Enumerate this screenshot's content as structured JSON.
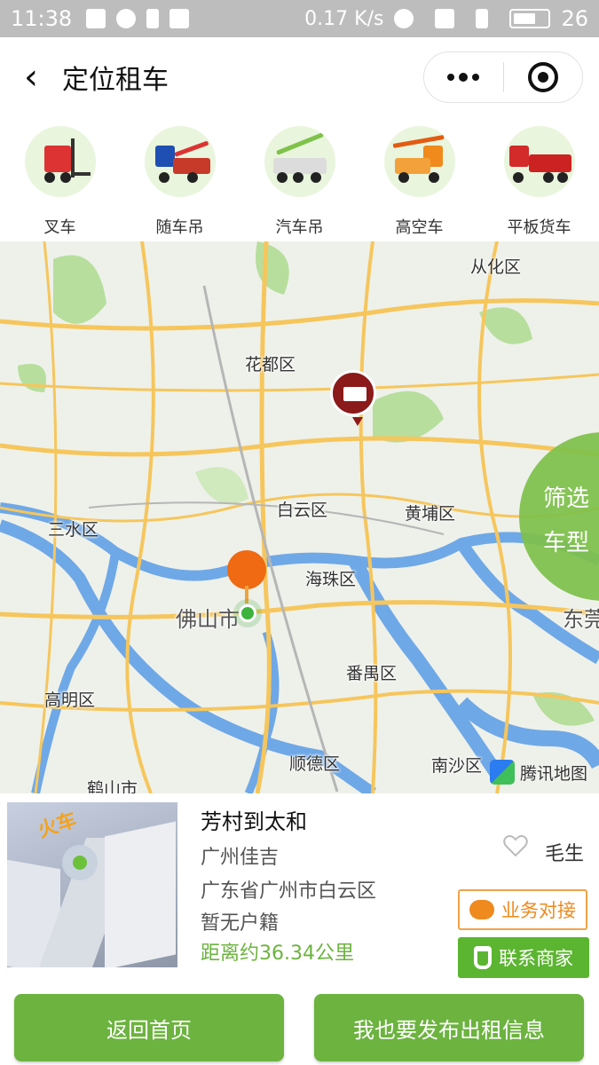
{
  "status_bar": {
    "time": "11:38",
    "net_speed": "0.17 K/s",
    "network": "2G 4G",
    "battery": "26"
  },
  "nav": {
    "title": "定位租车"
  },
  "categories": [
    {
      "label": "叉车",
      "icon": "forklift-icon"
    },
    {
      "label": "随车吊",
      "icon": "crane-truck-icon"
    },
    {
      "label": "汽车吊",
      "icon": "mobile-crane-icon"
    },
    {
      "label": "高空车",
      "icon": "aerial-truck-icon"
    },
    {
      "label": "平板货车",
      "icon": "flatbed-truck-icon"
    }
  ],
  "map": {
    "labels": {
      "conghua": "从化区",
      "huadu": "花都区",
      "baiyun": "白云区",
      "huangpu": "黄埔区",
      "sanshui": "三水区",
      "haizhu": "海珠区",
      "foshan": "佛山市",
      "dongguan": "东莞",
      "panyu": "番禺区",
      "gaoming": "高明区",
      "shunde": "顺德区",
      "nansha": "南沙区",
      "heshan": "鹤山市"
    },
    "filter": {
      "line1": "筛选",
      "line2": "车型"
    },
    "provider": "腾讯地图",
    "colors": {
      "water": "#6fa8e6",
      "green": "#a9d98a",
      "road": "#f6c65c",
      "filter": "#7ec04a"
    }
  },
  "listing": {
    "title": "芳村到太和",
    "company": "广州佳吉",
    "address": "广东省广州市白云区",
    "hukou": "暂无户籍",
    "distance": "距离约36.34公里",
    "owner": "毛生",
    "thumb_tag": "火车",
    "chat_label": "业务对接",
    "call_label": "联系商家"
  },
  "bottom": {
    "home_label": "返回首页",
    "publish_label": "我也要发布出租信息"
  }
}
